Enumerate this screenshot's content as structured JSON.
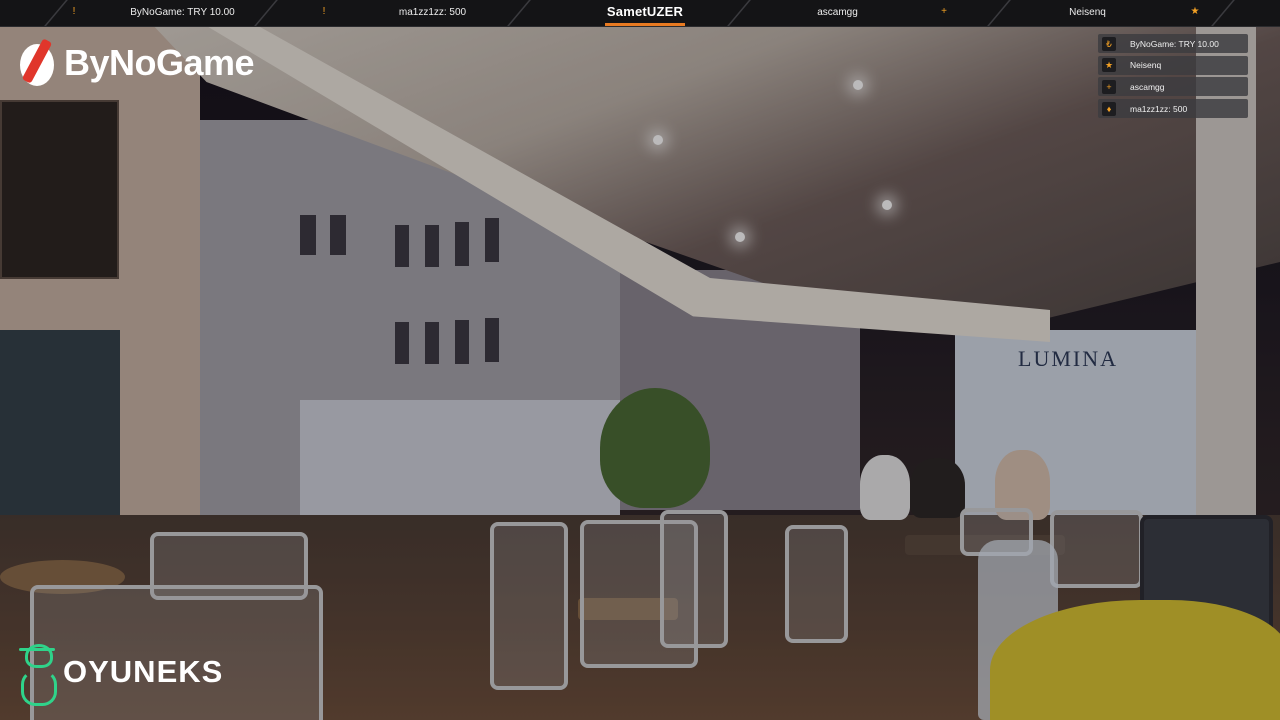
{
  "topbar": {
    "tickers": [
      {
        "label": "ByNoGame: TRY 10.00",
        "icon": "coin-icon",
        "icon_glyph": "!"
      },
      {
        "label": "ma1zz1zz: 500",
        "icon": "flame-icon",
        "icon_glyph": "!"
      },
      {
        "label": "ascamgg",
        "icon": "plus-icon",
        "icon_glyph": "+"
      },
      {
        "label": "Neisenq",
        "icon": "star-icon",
        "icon_glyph": "★"
      }
    ],
    "streamer_name": "SametUZER"
  },
  "brands": {
    "top_left": "ByNoGame",
    "bottom_left": "OYUNEKS"
  },
  "recent_events": [
    {
      "label": "ByNoGame: TRY 10.00",
      "icon": "coin-icon",
      "icon_glyph": "₺"
    },
    {
      "label": "Neisenq",
      "icon": "star-icon",
      "icon_glyph": "★"
    },
    {
      "label": "ascamgg",
      "icon": "plus-icon",
      "icon_glyph": "+"
    },
    {
      "label": "ma1zz1zz: 500",
      "icon": "flame-icon",
      "icon_glyph": "♦"
    }
  ],
  "scene_signs": {
    "cafe": "LUMINA"
  },
  "colors": {
    "accent": "#e87a21",
    "icon": "#f2a024",
    "bar": "#141416",
    "brand_red": "#e0362b",
    "brand_green": "#2fd38a"
  }
}
